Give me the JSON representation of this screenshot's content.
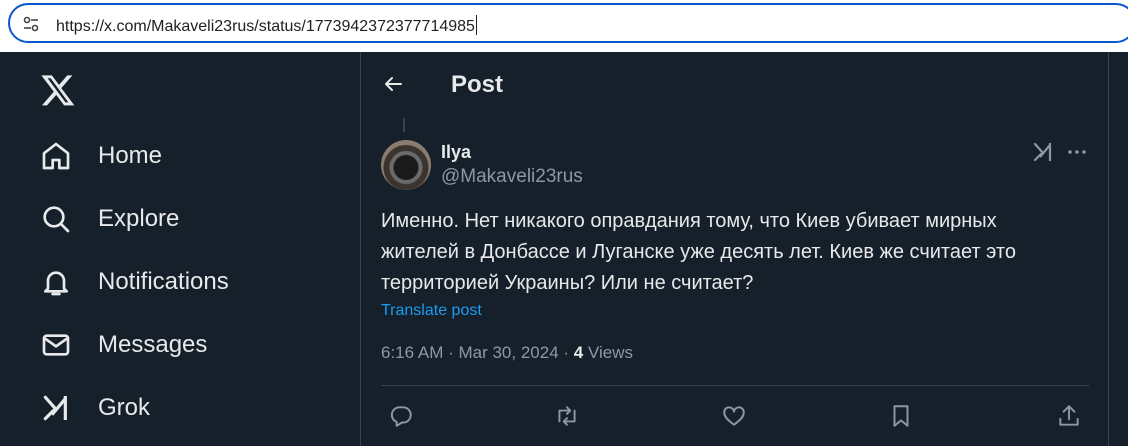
{
  "browser": {
    "url": "https://x.com/Makaveli23rus/status/1773942372377714985"
  },
  "sidebar": {
    "items": [
      {
        "label": "Home",
        "icon": "home-icon"
      },
      {
        "label": "Explore",
        "icon": "search-icon"
      },
      {
        "label": "Notifications",
        "icon": "bell-icon"
      },
      {
        "label": "Messages",
        "icon": "envelope-icon"
      },
      {
        "label": "Grok",
        "icon": "grok-icon"
      }
    ]
  },
  "header": {
    "title": "Post"
  },
  "post": {
    "display_name": "Ilya",
    "handle": "@Makaveli23rus",
    "text": "Именно. Нет никакого оправдания тому, что Киев убивает мирных жителей в Донбассе и Луганске уже десять лет. Киев же считает это территорией Украины? Или не считает?",
    "translate_label": "Translate post",
    "time": "6:16 AM · Mar 30, 2024 · ",
    "views_count": "4",
    "views_label": " Views"
  },
  "actions": [
    "reply-icon",
    "repost-icon",
    "like-icon",
    "bookmark-icon",
    "share-icon"
  ],
  "colors": {
    "background": "#15202b",
    "text": "#e7e9ea",
    "muted": "#8b98a5",
    "accent": "#1d9bf0",
    "border": "#38444d"
  }
}
